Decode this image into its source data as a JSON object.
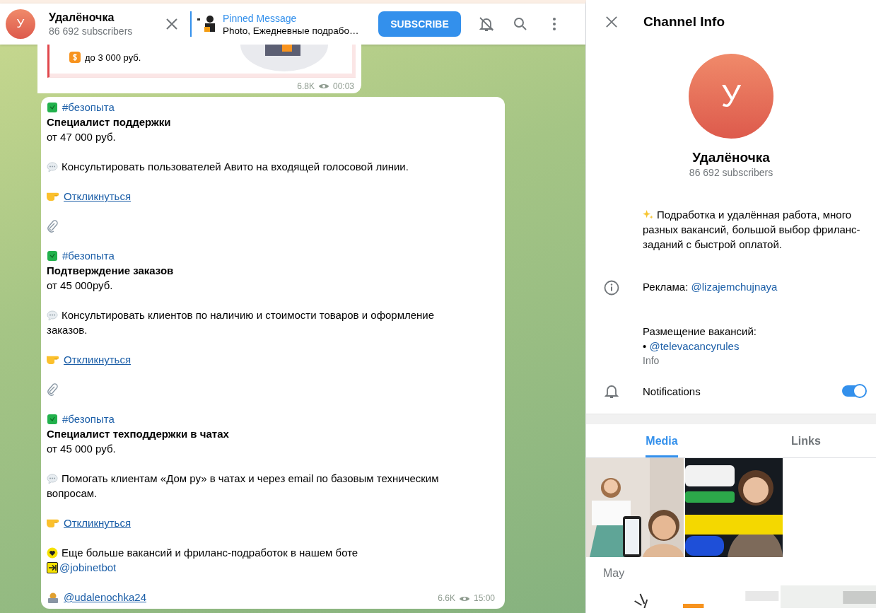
{
  "chat_header": {
    "avatar_letter": "У",
    "title": "Удалёночка",
    "subtitle": "86 692 subscribers",
    "pinned": {
      "label": "Pinned Message",
      "text": "Photo, Ежедневные подрабо…"
    },
    "subscribe_button": "SUBSCRIBE",
    "muted": true
  },
  "messages": [
    {
      "kind": "card",
      "card_text": "до 3 000 руб.",
      "views": "6.8K",
      "time": "00:03"
    },
    {
      "kind": "text",
      "views": "6.6K",
      "time": "15:00",
      "paragraphs": [
        {
          "lines": [
            {
              "kind": "tag",
              "text": "#безопыта"
            },
            {
              "kind": "title",
              "text": "Специалист поддержки"
            },
            {
              "kind": "text",
              "text": "от 47 000 руб."
            }
          ]
        },
        {
          "lines": [
            {
              "kind": "desc",
              "text": "Консультировать пользователей Авито на входящей голосовой линии."
            }
          ]
        },
        {
          "lines": [
            {
              "kind": "link",
              "text": "Откликнуться"
            }
          ]
        },
        {
          "lines": [
            {
              "kind": "clip"
            }
          ]
        },
        {
          "lines": [
            {
              "kind": "tag",
              "text": "#безопыта"
            },
            {
              "kind": "title",
              "text": "Подтверждение заказов"
            },
            {
              "kind": "text",
              "text": "от 45 000руб."
            }
          ]
        },
        {
          "lines": [
            {
              "kind": "desc",
              "text": "Консультировать клиентов по наличию и стоимости товаров и оформление заказов."
            }
          ]
        },
        {
          "lines": [
            {
              "kind": "link",
              "text": "Откликнуться"
            }
          ]
        },
        {
          "lines": [
            {
              "kind": "clip"
            }
          ]
        },
        {
          "lines": [
            {
              "kind": "tag",
              "text": "#безопыта"
            },
            {
              "kind": "title",
              "text": "Специалист техподдержки в чатах"
            },
            {
              "kind": "text",
              "text": "от 45 000 руб."
            }
          ]
        },
        {
          "lines": [
            {
              "kind": "desc",
              "text": "Помогать клиентам «Дом ру» в чатах и через email по базовым техническим вопросам."
            }
          ]
        },
        {
          "lines": [
            {
              "kind": "link",
              "text": "Откликнуться"
            }
          ]
        },
        {
          "lines": [
            {
              "kind": "promo",
              "text": "Еще больше вакансий и фриланс-подработок в нашем боте"
            },
            {
              "kind": "bot",
              "text": "@jobinetbot"
            }
          ]
        },
        {
          "lines": [
            {
              "kind": "contact",
              "text": "@udalenochka24"
            }
          ]
        }
      ]
    }
  ],
  "info_panel": {
    "title": "Channel Info",
    "avatar_letter": "У",
    "name": "Удалёночка",
    "subtitle": "86 692 subscribers",
    "description": "Подработка и удалённая работа, много разных вакансий, большой выбор фриланс-заданий с быстрой оплатой.",
    "ad_label": "Реклама:",
    "ad_link": "@lizajemchujnaya",
    "jobs_label": "Размещение вакансий:",
    "jobs_bullet": "•",
    "jobs_link": "@televacancyrules",
    "info_caption": "Info",
    "notifications": {
      "label": "Notifications",
      "on": true
    },
    "tabs": [
      {
        "label": "Media",
        "selected": true
      },
      {
        "label": "Links",
        "selected": false
      }
    ],
    "month": "May"
  }
}
